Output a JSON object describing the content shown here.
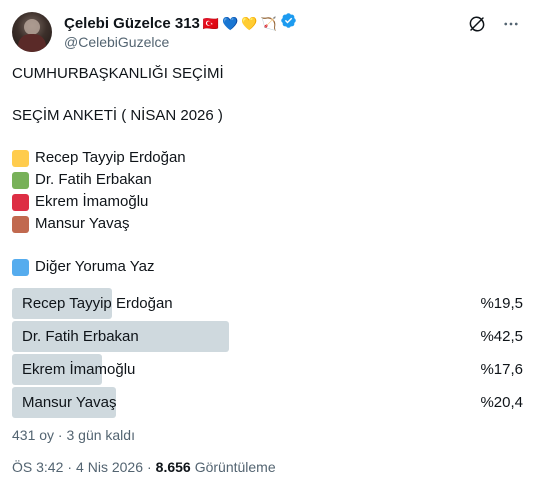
{
  "author": {
    "display_name": "Çelebi Güzelce 313",
    "handle": "@CelebiGuzelce",
    "flag_emoji": "🇹🇷",
    "heart_blue": "💙",
    "heart_yellow": "💛",
    "bow_emoji": "🏹",
    "verified_color": "#1d9bf0"
  },
  "post": {
    "title": "CUMHURBAŞKANLIĞI SEÇİMİ",
    "subtitle": "SEÇİM ANKETİ ( NİSAN 2026 )",
    "legend": [
      {
        "label": "Recep Tayyip Erdoğan",
        "color": "#ffcc4d"
      },
      {
        "label": "Dr. Fatih Erbakan",
        "color": "#78b159"
      },
      {
        "label": "Ekrem İmamoğlu",
        "color": "#dd2e44"
      },
      {
        "label": "Mansur Yavaş",
        "color": "#c1694f"
      }
    ],
    "other": {
      "label": "Diğer Yoruma Yaz",
      "color": "#55acee"
    }
  },
  "poll": {
    "options": [
      {
        "label": "Recep Tayyip Erdoğan",
        "percent_text": "%19,5",
        "percent": 19.5
      },
      {
        "label": "Dr. Fatih Erbakan",
        "percent_text": "%42,5",
        "percent": 42.5
      },
      {
        "label": "Ekrem İmamoğlu",
        "percent_text": "%17,6",
        "percent": 17.6
      },
      {
        "label": "Mansur Yavaş",
        "percent_text": "%20,4",
        "percent": 20.4
      }
    ],
    "meta": "431 oy · 3 gün kaldı"
  },
  "footer": {
    "time": "ÖS 3:42",
    "sep1": "·",
    "date": "4 Nis 2026",
    "sep2": "·",
    "views_count": "8.656",
    "views_label": "Görüntüleme"
  }
}
